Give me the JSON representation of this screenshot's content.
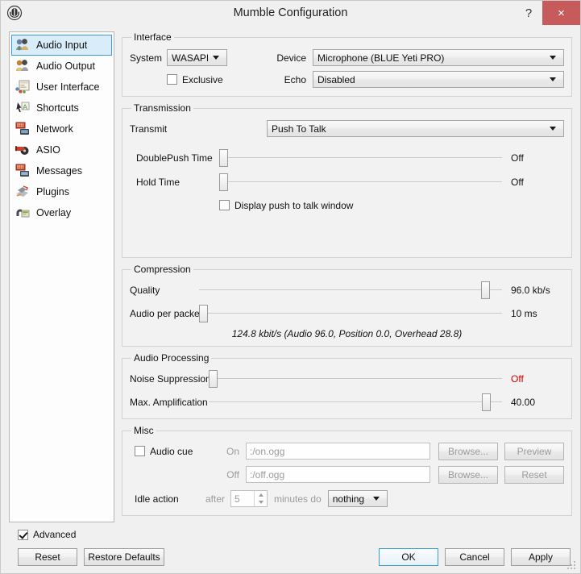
{
  "window": {
    "title": "Mumble Configuration",
    "app_icon": "mumble-logo-icon",
    "help_label": "?",
    "close_label": "×"
  },
  "sidebar": {
    "items": [
      {
        "label": "Audio Input",
        "icon": "audio-input-icon",
        "selected": true
      },
      {
        "label": "Audio Output",
        "icon": "audio-output-icon",
        "selected": false
      },
      {
        "label": "User Interface",
        "icon": "user-interface-icon",
        "selected": false
      },
      {
        "label": "Shortcuts",
        "icon": "shortcuts-icon",
        "selected": false
      },
      {
        "label": "Network",
        "icon": "network-icon",
        "selected": false
      },
      {
        "label": "ASIO",
        "icon": "asio-icon",
        "selected": false
      },
      {
        "label": "Messages",
        "icon": "messages-icon",
        "selected": false
      },
      {
        "label": "Plugins",
        "icon": "plugins-icon",
        "selected": false
      },
      {
        "label": "Overlay",
        "icon": "overlay-icon",
        "selected": false
      }
    ]
  },
  "interface": {
    "legend": "Interface",
    "system_label": "System",
    "system_value": "WASAPI",
    "device_label": "Device",
    "device_value": "Microphone (BLUE Yeti PRO)",
    "exclusive_label": "Exclusive",
    "exclusive_checked": false,
    "echo_label": "Echo",
    "echo_value": "Disabled"
  },
  "transmission": {
    "legend": "Transmission",
    "transmit_label": "Transmit",
    "transmit_value": "Push To Talk",
    "doublepush_label": "DoublePush Time",
    "doublepush_value": "Off",
    "doublepush_percent": 0,
    "hold_label": "Hold Time",
    "hold_value": "Off",
    "hold_percent": 0,
    "pttwindow_label": "Display push to talk window",
    "pttwindow_checked": false
  },
  "compression": {
    "legend": "Compression",
    "quality_label": "Quality",
    "quality_value": "96.0 kb/s",
    "quality_percent": 96,
    "packet_label": "Audio per packet",
    "packet_value": "10 ms",
    "packet_percent": 0,
    "bitrate_text": "124.8 kbit/s (Audio 96.0, Position 0.0, Overhead 28.8)"
  },
  "audio_processing": {
    "legend": "Audio Processing",
    "noise_label": "Noise Suppression",
    "noise_value": "Off",
    "noise_percent": 0,
    "noise_value_color": "#cc0000",
    "amp_label": "Max. Amplification",
    "amp_value": "40.00",
    "amp_percent": 96
  },
  "misc": {
    "legend": "Misc",
    "audio_cue_label": "Audio cue",
    "audio_cue_checked": false,
    "on_label": "On",
    "on_value": ":/on.ogg",
    "on_browse_label": "Browse...",
    "preview_label": "Preview",
    "off_label": "Off",
    "off_value": ":/off.ogg",
    "off_browse_label": "Browse...",
    "reset_label": "Reset",
    "idle_action_label": "Idle action",
    "idle_after_label": "after",
    "idle_minutes_value": "5",
    "idle_minutes_label": "minutes do",
    "idle_do_value": "nothing"
  },
  "footer": {
    "advanced_label": "Advanced",
    "advanced_checked": true,
    "reset_label": "Reset",
    "restore_defaults_label": "Restore Defaults",
    "ok_label": "OK",
    "cancel_label": "Cancel",
    "apply_label": "Apply"
  }
}
